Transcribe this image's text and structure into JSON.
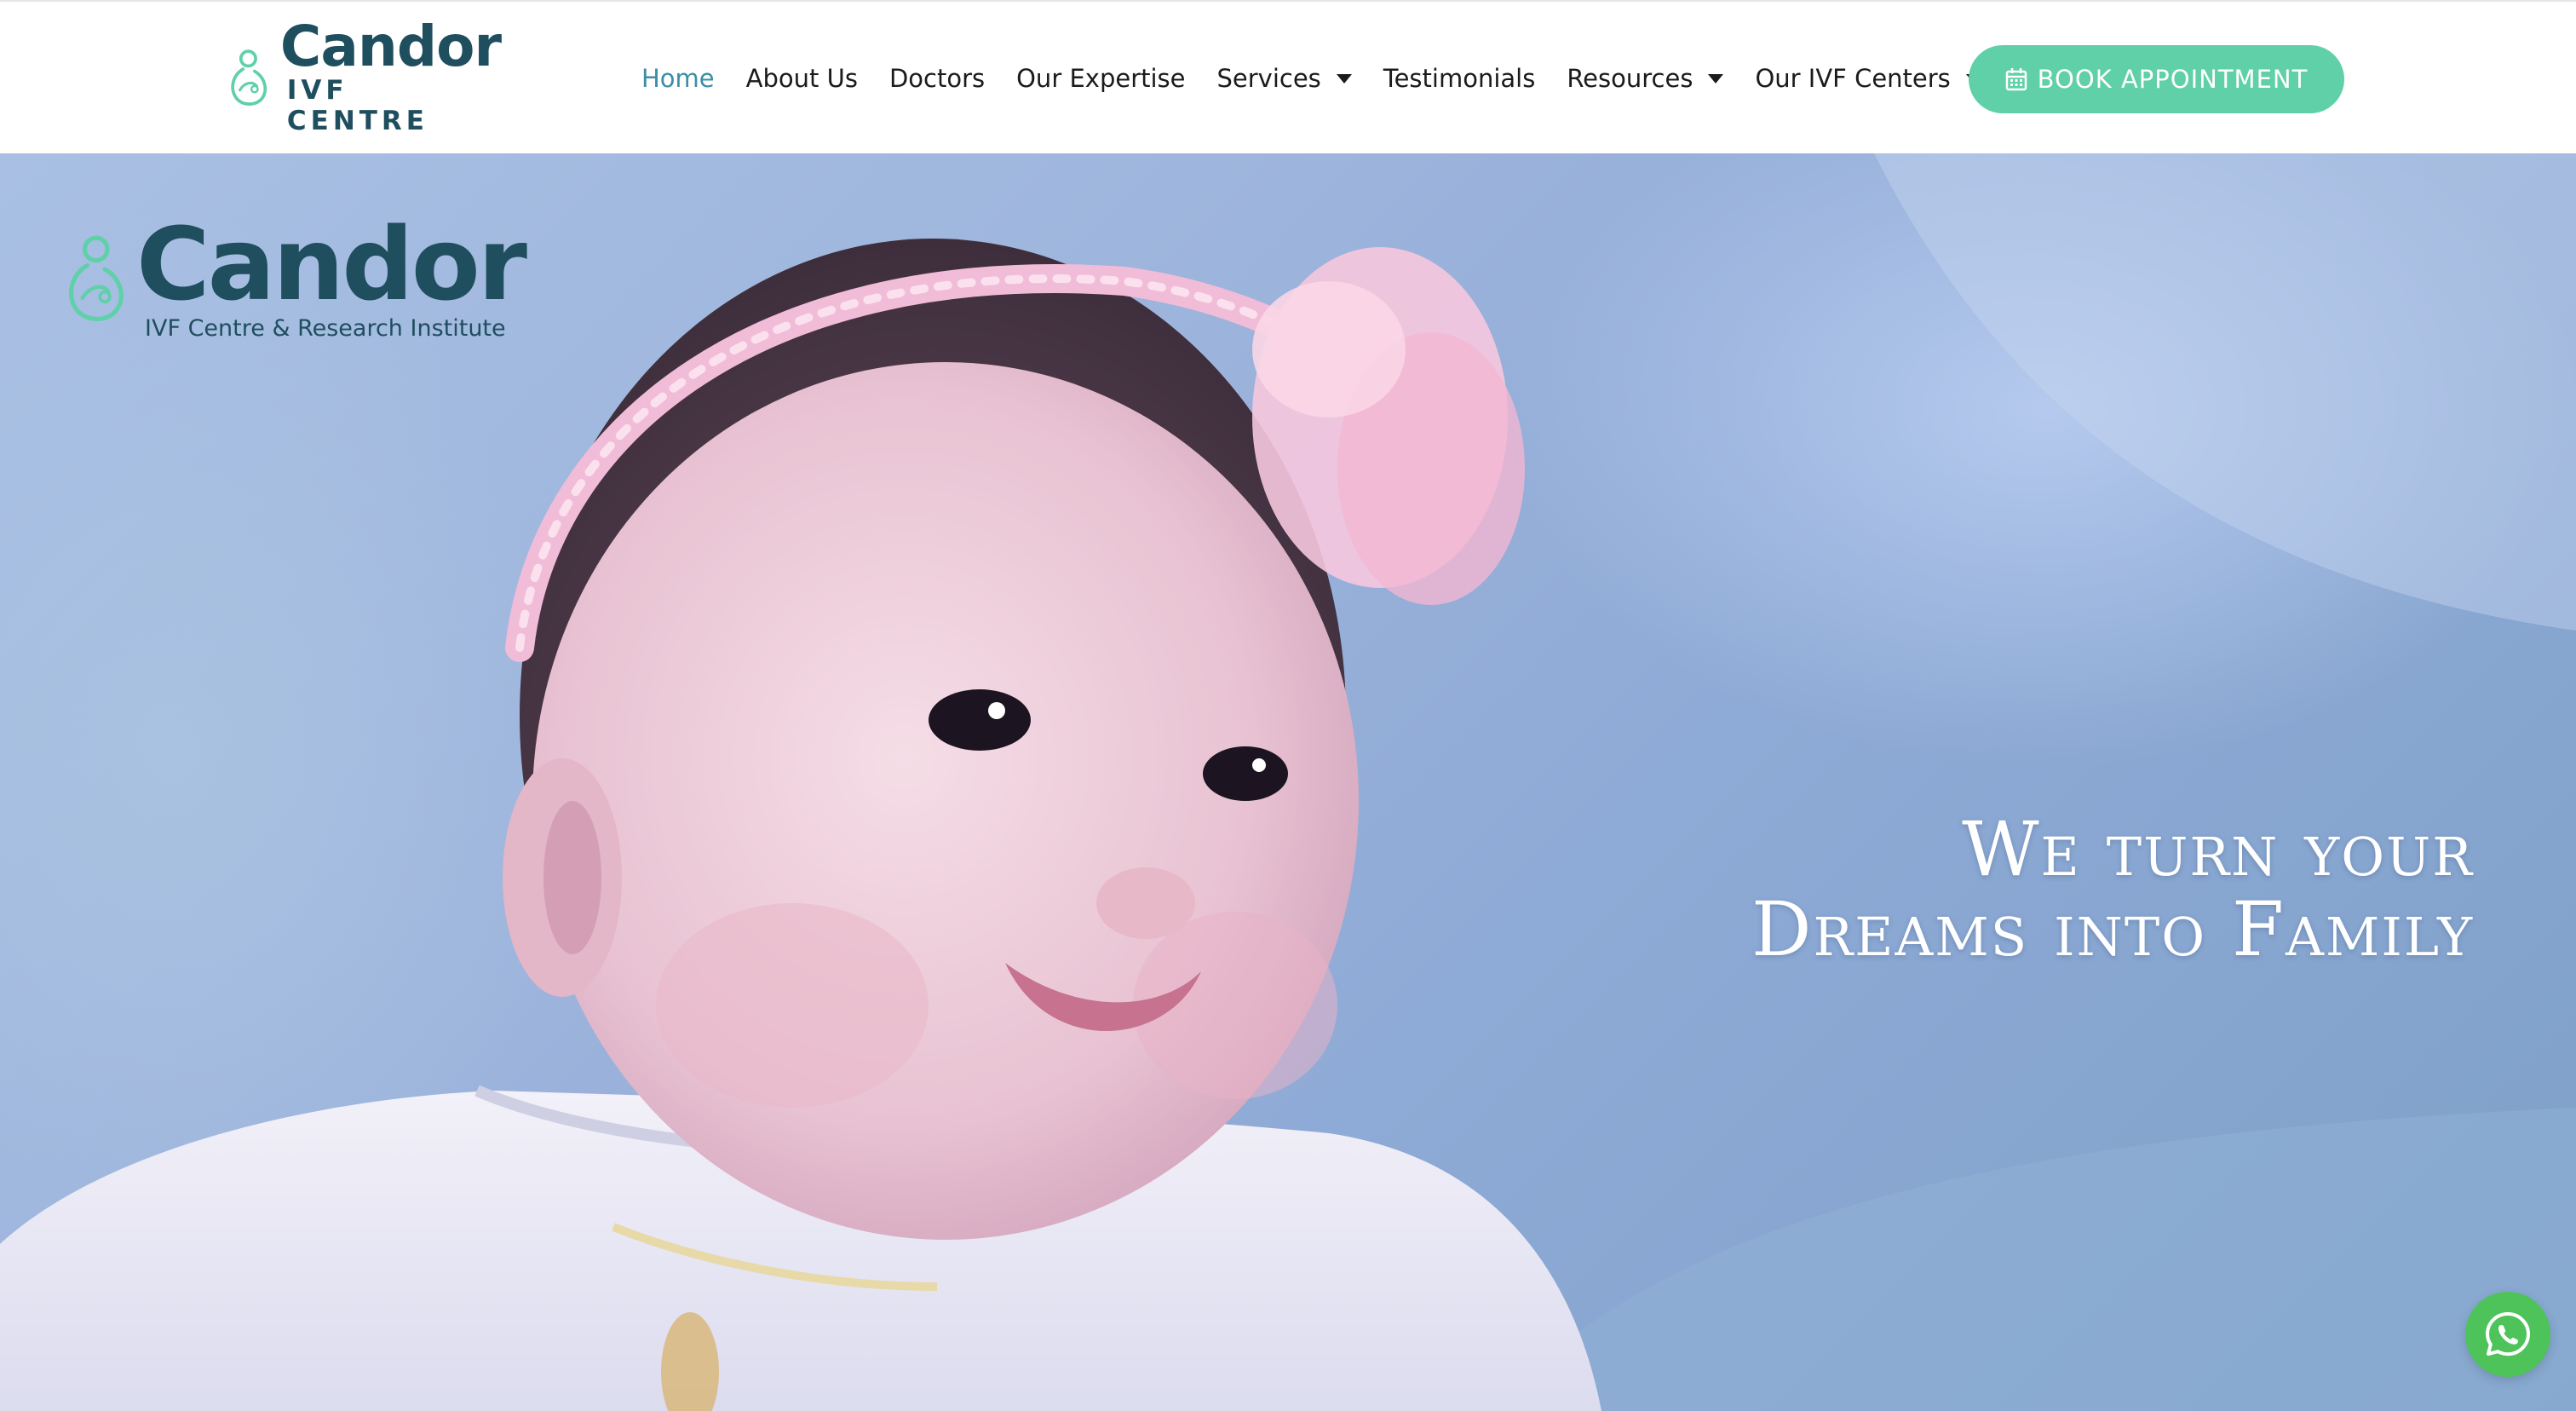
{
  "header": {
    "brand": {
      "name": "Candor",
      "subtitle": "IVF CENTRE"
    },
    "nav": [
      {
        "label": "Home",
        "active": true,
        "has_dropdown": false
      },
      {
        "label": "About Us",
        "active": false,
        "has_dropdown": false
      },
      {
        "label": "Doctors",
        "active": false,
        "has_dropdown": false
      },
      {
        "label": "Our Expertise",
        "active": false,
        "has_dropdown": false
      },
      {
        "label": "Services",
        "active": false,
        "has_dropdown": true
      },
      {
        "label": "Testimonials",
        "active": false,
        "has_dropdown": false
      },
      {
        "label": "Resources",
        "active": false,
        "has_dropdown": true
      },
      {
        "label": "Our IVF Centers",
        "active": false,
        "has_dropdown": true
      }
    ],
    "book_button": {
      "label": "BOOK APPOINTMENT",
      "icon": "calendar-icon"
    }
  },
  "hero": {
    "logo": {
      "name": "Candor",
      "subtitle": "IVF Centre & Research Institute"
    },
    "tagline": {
      "line1": "We turn your",
      "line2": "Dreams into Family"
    }
  },
  "floating": {
    "whatsapp_icon": "whatsapp-icon"
  },
  "colors": {
    "brand_dark": "#1f4e5f",
    "brand_mint": "#5fd0a8",
    "nav_active": "#3b8ea5",
    "whatsapp_green": "#4dc35a"
  }
}
